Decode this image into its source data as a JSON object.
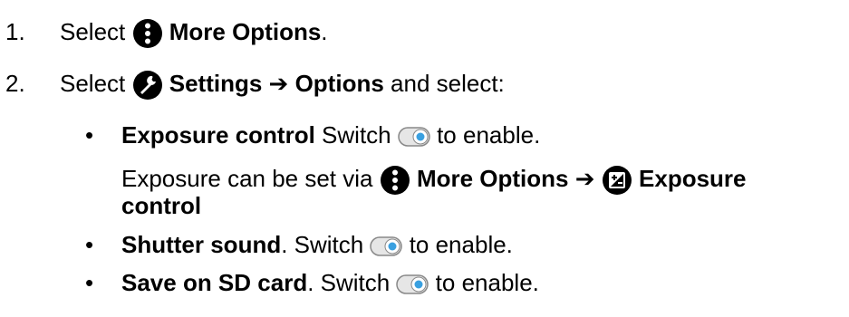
{
  "steps": [
    {
      "number": "1.",
      "select": "Select",
      "target": "More Options",
      "end": "."
    },
    {
      "number": "2.",
      "select": "Select",
      "target": "Settings",
      "arrow": "➔",
      "target2": "Options",
      "end": " and select:"
    }
  ],
  "bullets": [
    {
      "marker": "•",
      "title": "Exposure control",
      "after_title": " Switch ",
      "action": " to enable.",
      "note_prefix": "Exposure can be set via ",
      "note_target": "More Options",
      "note_arrow": "➔",
      "note_target2": "Exposure",
      "note_target2_cont": "control"
    },
    {
      "marker": "•",
      "title": "Shutter sound",
      "after_title": ". Switch ",
      "action": " to enable."
    },
    {
      "marker": "•",
      "title": "Save on SD card",
      "after_title": ". Switch ",
      "action": " to enable."
    }
  ],
  "icons": {
    "more_options": "more-options-icon",
    "settings": "wrench-icon",
    "switch": "toggle-switch-icon",
    "exposure": "exposure-icon"
  },
  "colors": {
    "text": "#000000",
    "icon": "#000000",
    "switch_knob": "#3aa0e0"
  }
}
